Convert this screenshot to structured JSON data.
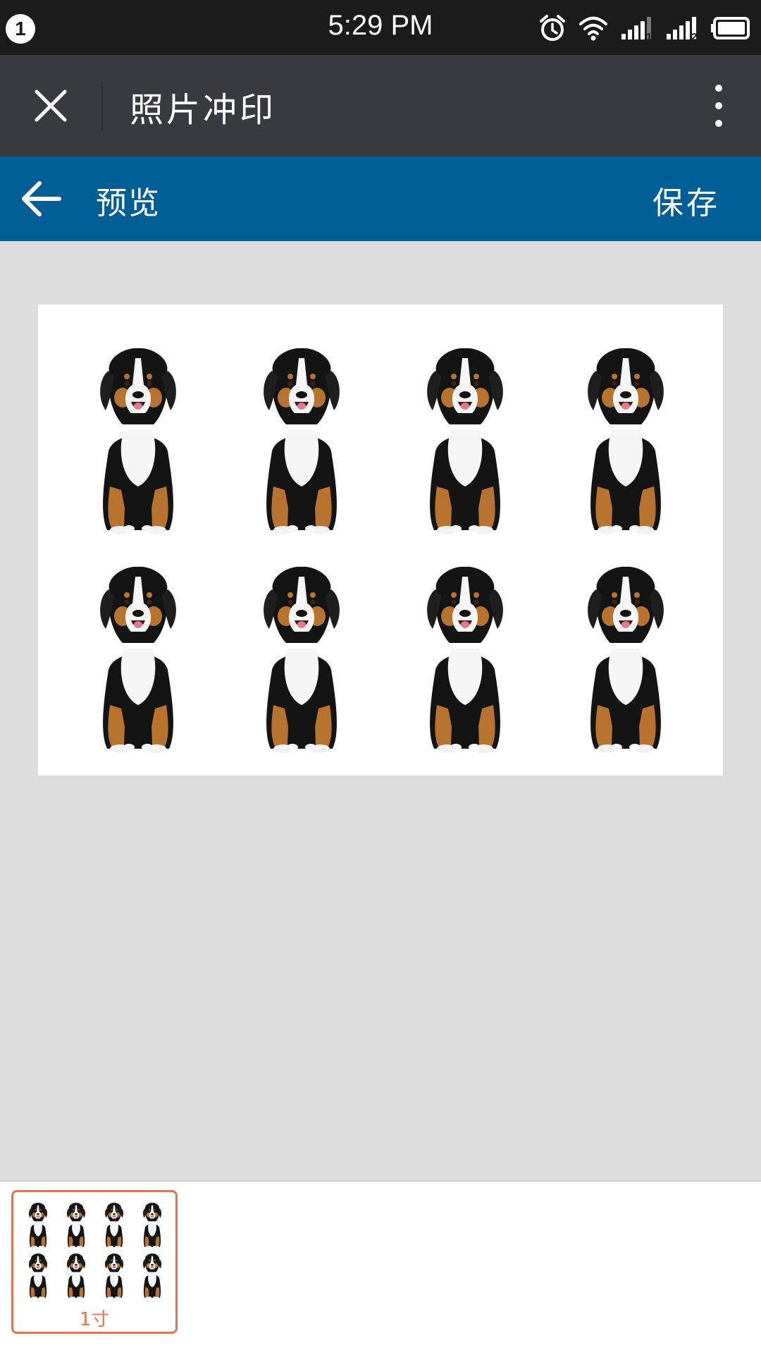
{
  "status_bar": {
    "notification_count": "1",
    "time": "5:29 PM",
    "icons": [
      "alarm-icon",
      "wifi-icon",
      "signal-sim1-icon",
      "signal-sim2-icon",
      "battery-icon"
    ],
    "sim1_label": "1",
    "sim2_label": "2"
  },
  "titlebar": {
    "title": "照片冲印",
    "close_icon": "close-icon",
    "more_icon": "more-vertical-icon"
  },
  "subheader": {
    "title": "预览",
    "save_label": "保存",
    "back_icon": "arrow-left-icon"
  },
  "preview": {
    "rows": 2,
    "columns": 4,
    "photo_subject": "dog-photo"
  },
  "template_list": {
    "items": [
      {
        "label": "1寸",
        "selected": true
      }
    ]
  },
  "colors": {
    "status_bar": "#1b1b1c",
    "titlebar": "#393a3f",
    "subheader": "#005e96",
    "background": "#dddddd",
    "accent": "#e8734e"
  }
}
